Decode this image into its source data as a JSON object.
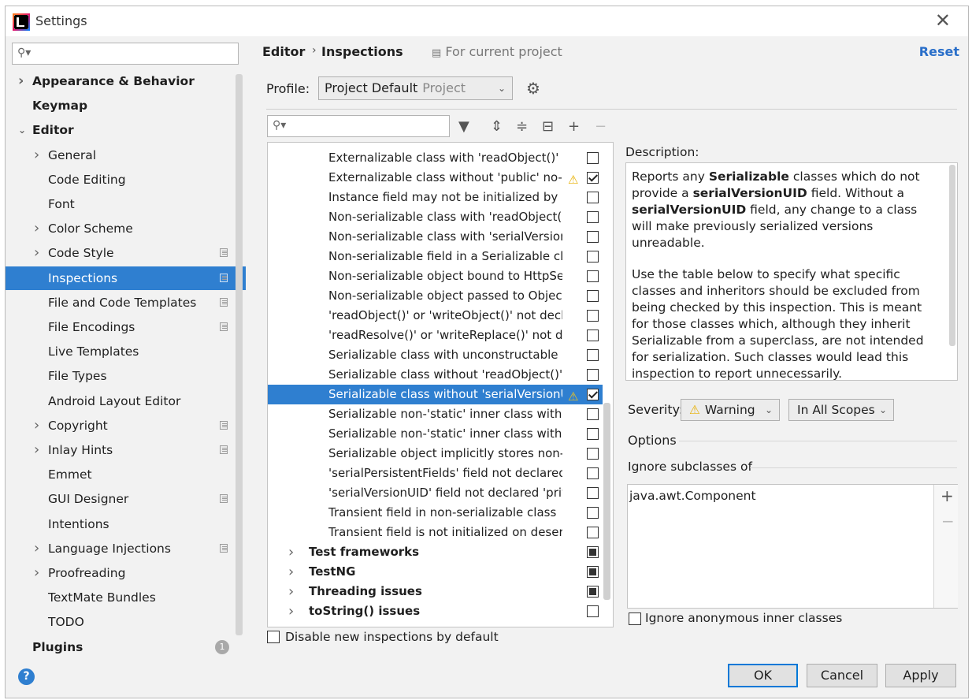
{
  "window": {
    "title": "Settings"
  },
  "left": {
    "search_placeholder": "",
    "items": [
      {
        "label": "Appearance & Behavior",
        "bold": true,
        "arrow": "right",
        "indent": 0
      },
      {
        "label": "Keymap",
        "bold": true,
        "arrow": "",
        "indent": 0
      },
      {
        "label": "Editor",
        "bold": true,
        "arrow": "down",
        "indent": 0
      },
      {
        "label": "General",
        "arrow": "right",
        "indent": 1
      },
      {
        "label": "Code Editing",
        "arrow": "",
        "indent": 1
      },
      {
        "label": "Font",
        "arrow": "",
        "indent": 1
      },
      {
        "label": "Color Scheme",
        "arrow": "right",
        "indent": 1
      },
      {
        "label": "Code Style",
        "arrow": "right",
        "indent": 1,
        "copy": true
      },
      {
        "label": "Inspections",
        "arrow": "",
        "indent": 1,
        "copy": true,
        "selected": true
      },
      {
        "label": "File and Code Templates",
        "arrow": "",
        "indent": 1,
        "copy": true
      },
      {
        "label": "File Encodings",
        "arrow": "",
        "indent": 1,
        "copy": true
      },
      {
        "label": "Live Templates",
        "arrow": "",
        "indent": 1
      },
      {
        "label": "File Types",
        "arrow": "",
        "indent": 1
      },
      {
        "label": "Android Layout Editor",
        "arrow": "",
        "indent": 1
      },
      {
        "label": "Copyright",
        "arrow": "right",
        "indent": 1,
        "copy": true
      },
      {
        "label": "Inlay Hints",
        "arrow": "right",
        "indent": 1,
        "copy": true
      },
      {
        "label": "Emmet",
        "arrow": "",
        "indent": 1
      },
      {
        "label": "GUI Designer",
        "arrow": "",
        "indent": 1,
        "copy": true
      },
      {
        "label": "Intentions",
        "arrow": "",
        "indent": 1
      },
      {
        "label": "Language Injections",
        "arrow": "right",
        "indent": 1,
        "copy": true
      },
      {
        "label": "Proofreading",
        "arrow": "right",
        "indent": 1
      },
      {
        "label": "TextMate Bundles",
        "arrow": "",
        "indent": 1
      },
      {
        "label": "TODO",
        "arrow": "",
        "indent": 1
      },
      {
        "label": "Plugins",
        "bold": true,
        "arrow": "",
        "indent": 0,
        "badge": "1"
      }
    ]
  },
  "breadcrumb": {
    "first": "Editor",
    "second": "Inspections",
    "scope": "For current project",
    "reset": "Reset"
  },
  "profile": {
    "label": "Profile:",
    "value": "Project Default",
    "qualifier": "Project"
  },
  "inspections": {
    "rows": [
      {
        "label": "Externalizable class with 'readObject()' or",
        "checked": false
      },
      {
        "label": "Externalizable class without 'public' no-ar",
        "checked": true,
        "warn": true
      },
      {
        "label": "Instance field may not be initialized by 're",
        "checked": false
      },
      {
        "label": "Non-serializable class with 'readObject()'",
        "checked": false
      },
      {
        "label": "Non-serializable class with 'serialVersionU",
        "checked": false
      },
      {
        "label": "Non-serializable field in a Serializable clas",
        "checked": false
      },
      {
        "label": "Non-serializable object bound to HttpSe",
        "checked": false
      },
      {
        "label": "Non-serializable object passed to Object",
        "checked": false
      },
      {
        "label": "'readObject()' or 'writeObject()' not decla",
        "checked": false
      },
      {
        "label": "'readResolve()' or 'writeReplace()' not de",
        "checked": false
      },
      {
        "label": "Serializable class with unconstructable ar",
        "checked": false
      },
      {
        "label": "Serializable class without 'readObject()' a",
        "checked": false
      },
      {
        "label": "Serializable class without 'serialVersionUI",
        "checked": true,
        "warn": true,
        "selected": true
      },
      {
        "label": "Serializable non-'static' inner class with n",
        "checked": false
      },
      {
        "label": "Serializable non-'static' inner class withou",
        "checked": false
      },
      {
        "label": "Serializable object implicitly stores non-S",
        "checked": false
      },
      {
        "label": "'serialPersistentFields' field not declared",
        "checked": false
      },
      {
        "label": "'serialVersionUID' field not declared 'priv",
        "checked": false
      },
      {
        "label": "Transient field in non-serializable class",
        "checked": false
      },
      {
        "label": "Transient field is not initialized on deseri",
        "checked": false
      },
      {
        "label": "Test frameworks",
        "group": true,
        "state": "partial"
      },
      {
        "label": "TestNG",
        "group": true,
        "state": "partial"
      },
      {
        "label": "Threading issues",
        "group": true,
        "state": "partial"
      },
      {
        "label": "toString() issues",
        "group": true,
        "state": "none"
      }
    ],
    "disable_new_label": "Disable new inspections by default"
  },
  "description": {
    "label": "Description:",
    "p1_parts": [
      "Reports any ",
      "Serializable",
      " classes which do not provide a ",
      "serialVersionUID",
      " field. Without a ",
      "serialVersionUID",
      " field, any change to a class will make previously serialized versions unreadable."
    ],
    "p2": "Use the table below to specify what specific classes and inheritors should be excluded from being checked by this inspection. This is meant for those classes which, although they inherit Serializable from a superclass, are not intended for serialization. Such classes would lead this inspection to report unnecessarily."
  },
  "severity": {
    "label": "Severity:",
    "value": "Warning",
    "scope": "In All Scopes"
  },
  "options": {
    "label": "Options",
    "ignore_label": "Ignore subclasses of",
    "ignore_items": [
      "java.awt.Component"
    ],
    "anon_label": "Ignore anonymous inner classes"
  },
  "buttons": {
    "ok": "OK",
    "cancel": "Cancel",
    "apply": "Apply"
  },
  "colors": {
    "selection": "#2f7fd0",
    "link": "#2a6fc9",
    "warning": "#e8b000"
  }
}
